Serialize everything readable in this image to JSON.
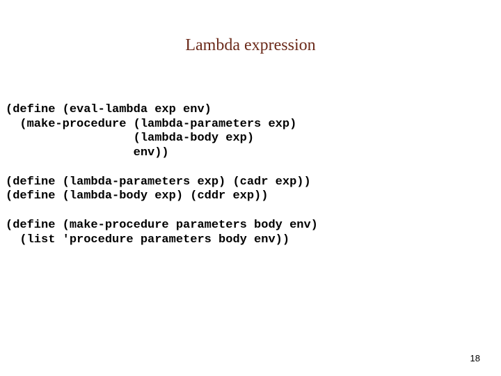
{
  "title": "Lambda expression",
  "code": {
    "l1": "(define (eval-lambda exp env)",
    "l2": "  (make-procedure (lambda-parameters exp)",
    "l3": "                  (lambda-body exp)",
    "l4": "                  env))",
    "l5": "",
    "l6": "(define (lambda-parameters exp) (cadr exp))",
    "l7": "(define (lambda-body exp) (cddr exp))",
    "l8": "",
    "l9": "(define (make-procedure parameters body env)",
    "l10": "  (list 'procedure parameters body env))"
  },
  "page_number": "18"
}
